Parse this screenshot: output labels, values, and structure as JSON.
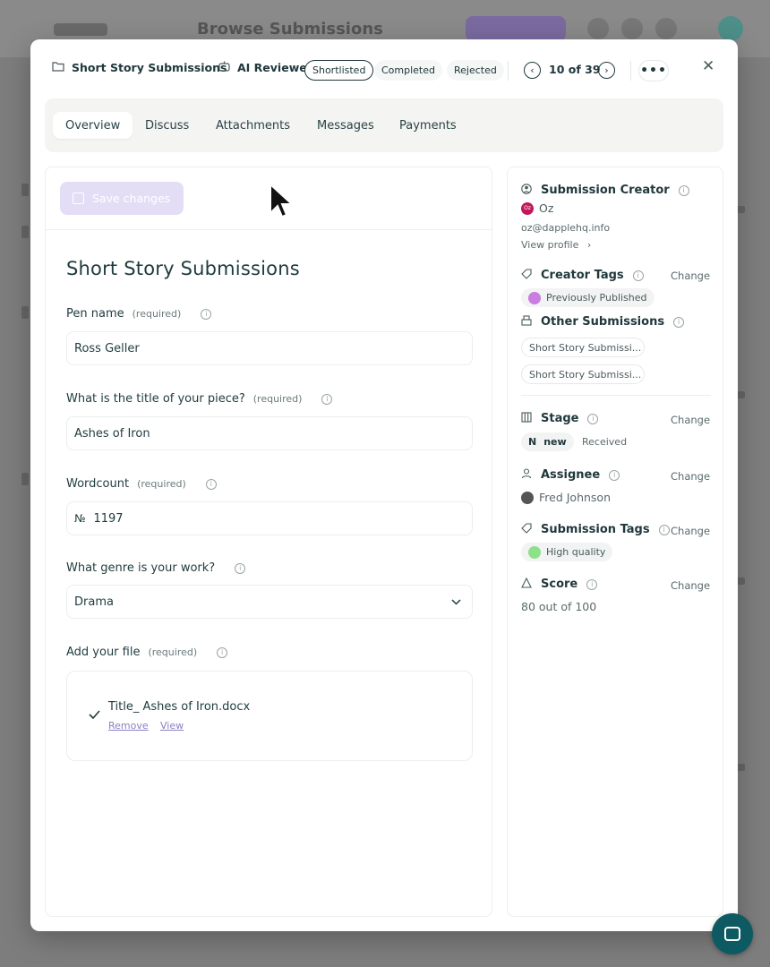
{
  "background": {
    "app_title": "Browse Submissions"
  },
  "header": {
    "form_name": "Short Story Submissions",
    "ai_label": "AI Reviewed",
    "statuses": [
      "Shortlisted",
      "Completed",
      "Rejected"
    ],
    "active_status": "Shortlisted",
    "counter": "10 of 39",
    "more_label": "•••",
    "close_label": "✕"
  },
  "tabs": [
    "Overview",
    "Discuss",
    "Attachments",
    "Messages",
    "Payments"
  ],
  "active_tab": "Overview",
  "form": {
    "save_label": "Save changes",
    "title": "Short Story Submissions",
    "required_label": "(required)",
    "fields": {
      "pen_name": {
        "label": "Pen name",
        "value": "Ross Geller"
      },
      "title": {
        "label": "What is the title of your piece?",
        "value": "Ashes of Iron"
      },
      "wordcount": {
        "label": "Wordcount",
        "prefix": "№",
        "value": "1197"
      },
      "genre": {
        "label": "What genre is your work?",
        "value": "Drama"
      },
      "file": {
        "label": "Add your file",
        "file_name": "Title_ Ashes of Iron.docx",
        "remove_label": "Remove",
        "view_label": "View"
      }
    }
  },
  "sidebar": {
    "creator": {
      "heading": "Submission Creator",
      "avatar_initials": "Oz",
      "name": "Oz",
      "email": "oz@dapplehq.info",
      "view_profile": "View profile"
    },
    "change_label": "Change",
    "creator_tags": {
      "heading": "Creator Tags",
      "tag": "Previously Published"
    },
    "other_submissions": {
      "heading": "Other Submissions",
      "items": [
        "Short Story Submissi...",
        "Short Story Submissi..."
      ]
    },
    "stage": {
      "heading": "Stage",
      "badge_letter": "N",
      "badge_text": "new",
      "sub": "Received"
    },
    "assignee": {
      "heading": "Assignee",
      "name": "Fred Johnson"
    },
    "submission_tags": {
      "heading": "Submission Tags",
      "tag": "High quality"
    },
    "score": {
      "heading": "Score",
      "value": "80 out of 100"
    }
  },
  "colors": {
    "primary_text": "#1f3b3f",
    "save_button_disabled": "#e4ddf6",
    "link_purple": "#8b7fc2",
    "chat_bubble": "#0d5a62",
    "creator_avatar": "#c2185b",
    "creator_tag_dot": "#c97de0",
    "quality_tag_dot": "#8fe08a"
  }
}
